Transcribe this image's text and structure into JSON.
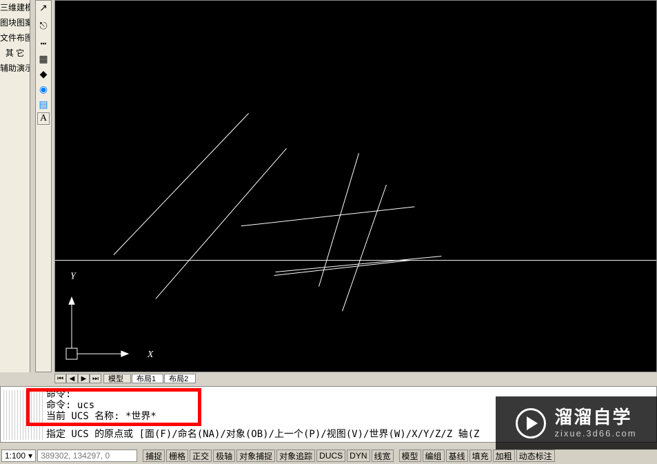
{
  "left_menu": {
    "items": [
      "三维建模",
      "图块图案",
      "文件布图",
      "其  它",
      "辅助演示"
    ]
  },
  "tool_icons": [
    "arrow-icon",
    "link-icon",
    "ellipsis-icon",
    "hash-icon",
    "target-icon",
    "camera-icon",
    "grid-icon",
    "text-icon"
  ],
  "tabs": {
    "nav_first": "⏮",
    "nav_prev": "◀",
    "nav_next": "▶",
    "nav_last": "⏭",
    "items": [
      "模型",
      "布局1",
      "布局2"
    ]
  },
  "cmd": {
    "history": "命令:\n命令: ucs\n当前 UCS 名称: *世界*",
    "prompt": "指定 UCS 的原点或 [面(F)/命名(NA)/对象(OB)/上一个(P)/视图(V)/世界(W)/X/Y/Z/Z 轴(Z"
  },
  "status": {
    "scale": "1:100",
    "coord": "389302, 134297, 0",
    "buttons": [
      "捕捉",
      "栅格",
      "正交",
      "极轴",
      "对象捕捉",
      "对象追踪",
      "DUCS",
      "DYN",
      "线宽",
      "模型",
      "编组",
      "基线",
      "填充",
      "加粗",
      "动态标注"
    ]
  },
  "watermark": {
    "big": "溜溜自学",
    "small": "zixue.3d66.com"
  },
  "ucs": {
    "x": "X",
    "y": "Y"
  }
}
